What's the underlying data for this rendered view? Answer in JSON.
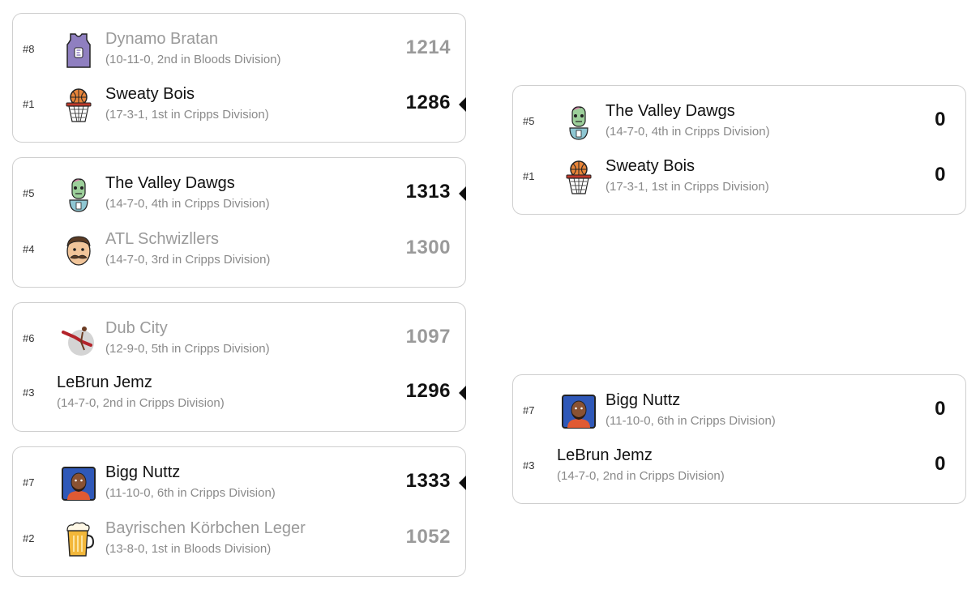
{
  "round1": [
    {
      "teams": [
        {
          "seed": "#8",
          "name": "Dynamo Bratan",
          "record": "(10-11-0, 2nd in Bloods Division)",
          "score": "1214",
          "winner": false,
          "icon": "purple-jersey-icon"
        },
        {
          "seed": "#1",
          "name": "Sweaty Bois",
          "record": "(17-3-1, 1st in Cripps Division)",
          "score": "1286",
          "winner": true,
          "icon": "basketball-hoop-icon"
        }
      ]
    },
    {
      "teams": [
        {
          "seed": "#5",
          "name": "The Valley Dawgs",
          "record": "(14-7-0, 4th in Cripps Division)",
          "score": "1313",
          "winner": true,
          "icon": "zombie-icon"
        },
        {
          "seed": "#4",
          "name": "ATL Schwizllers",
          "record": "(14-7-0, 3rd in Cripps Division)",
          "score": "1300",
          "winner": false,
          "icon": "mustache-man-icon"
        }
      ]
    },
    {
      "teams": [
        {
          "seed": "#6",
          "name": "Dub City",
          "record": "(12-9-0, 5th in Cripps Division)",
          "score": "1097",
          "winner": false,
          "icon": "dunking-player-icon"
        },
        {
          "seed": "#3",
          "name": "LeBrun Jemz",
          "record": "(14-7-0, 2nd in Cripps Division)",
          "score": "1296",
          "winner": true,
          "icon": ""
        }
      ]
    },
    {
      "teams": [
        {
          "seed": "#7",
          "name": "Bigg Nuttz",
          "record": "(11-10-0, 6th in Cripps Division)",
          "score": "1333",
          "winner": true,
          "icon": "player-portrait-icon"
        },
        {
          "seed": "#2",
          "name": "Bayrischen Körbchen Leger",
          "record": "(13-8-0, 1st in Bloods Division)",
          "score": "1052",
          "winner": false,
          "icon": "beer-mug-icon"
        }
      ]
    }
  ],
  "round2": [
    {
      "teams": [
        {
          "seed": "#5",
          "name": "The Valley Dawgs",
          "record": "(14-7-0, 4th in Cripps Division)",
          "score": "0",
          "icon": "zombie-icon"
        },
        {
          "seed": "#1",
          "name": "Sweaty Bois",
          "record": "(17-3-1, 1st in Cripps Division)",
          "score": "0",
          "icon": "basketball-hoop-icon"
        }
      ]
    },
    {
      "teams": [
        {
          "seed": "#7",
          "name": "Bigg Nuttz",
          "record": "(11-10-0, 6th in Cripps Division)",
          "score": "0",
          "icon": "player-portrait-icon"
        },
        {
          "seed": "#3",
          "name": "LeBrun Jemz",
          "record": "(14-7-0, 2nd in Cripps Division)",
          "score": "0",
          "icon": ""
        }
      ]
    }
  ],
  "colors": {
    "winner_text": "#111111",
    "loser_text": "#9a9a9a",
    "border": "#cfcfcf",
    "record_text": "#8a8a8a"
  }
}
